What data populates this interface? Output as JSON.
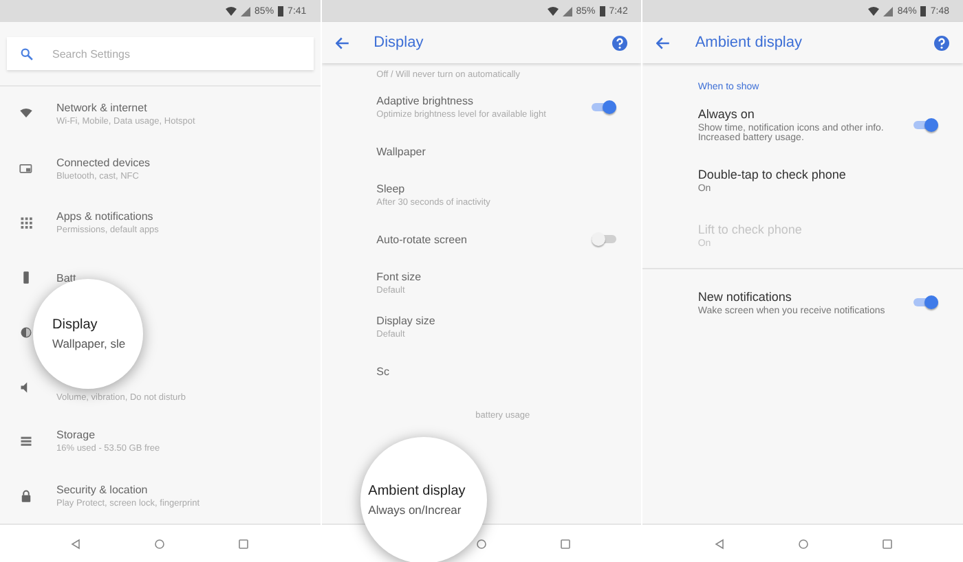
{
  "screens": [
    {
      "status_bar": {
        "battery": "85%",
        "time": "7:41"
      },
      "search": {
        "placeholder": "Search Settings"
      },
      "items": [
        {
          "kind": "plain",
          "title": "Network & internet",
          "subtitle": "Wi-Fi, Mobile, Data usage, Hotspot"
        },
        {
          "kind": "plain",
          "title": "Connected devices",
          "subtitle": "Bluetooth, cast, NFC"
        },
        {
          "kind": "plain",
          "title": "Apps & notifications",
          "subtitle": "Permissions, default apps"
        },
        {
          "kind": "plain",
          "title": "Batt"
        },
        {
          "kind": "plain"
        },
        {
          "kind": "plain",
          "subtitle": "Volume, vibration, Do not disturb"
        },
        {
          "kind": "plain",
          "title": "Storage",
          "subtitle": "16% used - 53.50 GB free"
        },
        {
          "kind": "plain",
          "title": "Security & location",
          "subtitle": "Play Protect, screen lock, fingerprint"
        }
      ],
      "magnifier": {
        "title": "Display",
        "subtitle": "Wallpaper, sle"
      }
    },
    {
      "status_bar": {
        "battery": "85%",
        "time": "7:42"
      },
      "app_bar": {
        "title": "Display"
      },
      "items": [
        {
          "kind": "plain",
          "subtitle": "Off / Will never turn on automatically"
        },
        {
          "kind": "switch",
          "on": true,
          "title": "Adaptive brightness",
          "subtitle": "Optimize brightness level for available light"
        },
        {
          "kind": "plain",
          "title": "Wallpaper"
        },
        {
          "kind": "plain",
          "title": "Sleep",
          "subtitle": "After 30 seconds of inactivity"
        },
        {
          "kind": "switch",
          "on": false,
          "title": "Auto-rotate screen"
        },
        {
          "kind": "plain",
          "title": "Font size",
          "subtitle": "Default"
        },
        {
          "kind": "plain",
          "title": "Display size",
          "subtitle": "Default"
        },
        {
          "kind": "plain",
          "title": "Sc"
        },
        {
          "kind": "covered",
          "subtitle": "battery usage"
        }
      ],
      "magnifier": {
        "title": "Ambient display",
        "subtitle": "Always on/Increar"
      }
    },
    {
      "status_bar": {
        "battery": "84%",
        "time": "7:48"
      },
      "app_bar": {
        "title": "Ambient display"
      },
      "section": "When to show",
      "items": [
        {
          "kind": "switch",
          "on": true,
          "disabled": false,
          "title": "Always on",
          "subtitle": "Show time, notification icons and other info. Increased battery usage."
        },
        {
          "kind": "plain",
          "disabled": false,
          "title": "Double-tap to check phone",
          "subtitle": "On"
        },
        {
          "kind": "plain",
          "disabled": true,
          "title": "Lift to check phone",
          "subtitle": "On"
        },
        {
          "kind": "divider"
        },
        {
          "kind": "switch",
          "on": true,
          "disabled": false,
          "title": "New notifications",
          "subtitle": "Wake screen when you receive notifications"
        }
      ]
    }
  ]
}
